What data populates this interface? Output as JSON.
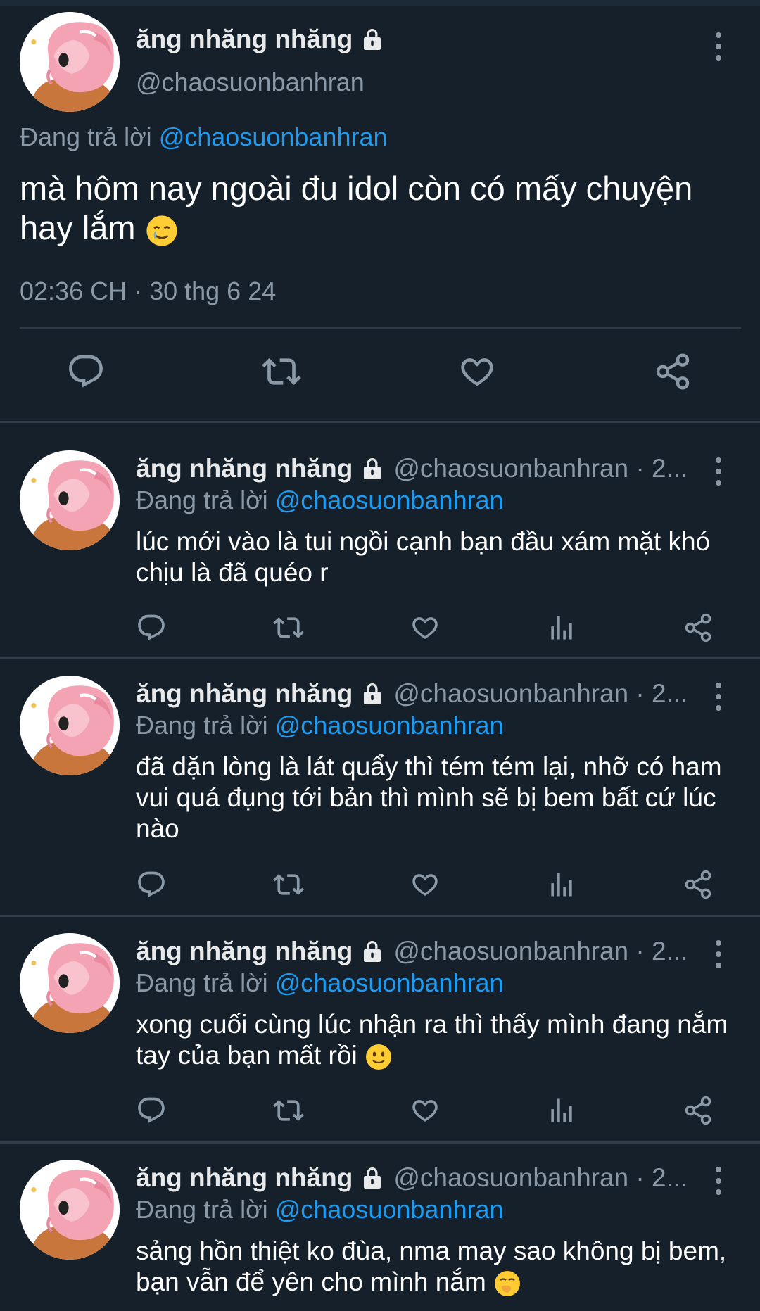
{
  "main_tweet": {
    "display_name": "ăng nhăng nhăng",
    "handle": "@chaosuonbanhran",
    "reply_prefix": "Đang trả lời",
    "reply_to": "@chaosuonbanhran",
    "text": "mà hôm nay ngoài đu idol còn có mấy chuyện hay lắm",
    "text_emoji": "smiling-face-with-tear",
    "timestamp": "02:36 CH · 30 thg 6 24"
  },
  "replies": [
    {
      "display_name": "ăng nhăng nhăng",
      "handle": "@chaosuonbanhran · 2...",
      "reply_prefix": "Đang trả lời",
      "reply_to": "@chaosuonbanhran",
      "text": "lúc mới vào là tui ngồi cạnh bạn đầu xám mặt khó chịu là đã quéo r"
    },
    {
      "display_name": "ăng nhăng nhăng",
      "handle": "@chaosuonbanhran · 2...",
      "reply_prefix": "Đang trả lời",
      "reply_to": "@chaosuonbanhran",
      "text": "đã dặn lòng là lát quẩy thì tém tém lại, nhỡ có ham vui quá đụng tới bản thì mình sẽ bị bem bất cứ lúc nào"
    },
    {
      "display_name": "ăng nhăng nhăng",
      "handle": "@chaosuonbanhran · 2...",
      "reply_prefix": "Đang trả lời",
      "reply_to": "@chaosuonbanhran",
      "text": "xong cuối cùng lúc nhận ra thì thấy mình đang nắm tay của bạn mất rồi",
      "emoji": "slightly-smiling-face"
    },
    {
      "display_name": "ăng nhăng nhăng",
      "handle": "@chaosuonbanhran · 2...",
      "reply_prefix": "Đang trả lời",
      "reply_to": "@chaosuonbanhran",
      "text": "sảng hồn thiệt ko đùa, nma may sao không bị bem, bạn vẫn để yên cho mình nắm",
      "emoji": "face-with-hand-over-mouth"
    }
  ],
  "icons": {
    "lock": "lock-icon",
    "more": "more-vertical-icon",
    "reply": "reply-icon",
    "retweet": "retweet-icon",
    "like": "heart-icon",
    "views": "views-icon",
    "share": "share-icon"
  },
  "colors": {
    "background": "#15202b",
    "mention": "#1d9bf0",
    "secondary_text": "#8b98a5",
    "divider": "#2f3b47"
  }
}
